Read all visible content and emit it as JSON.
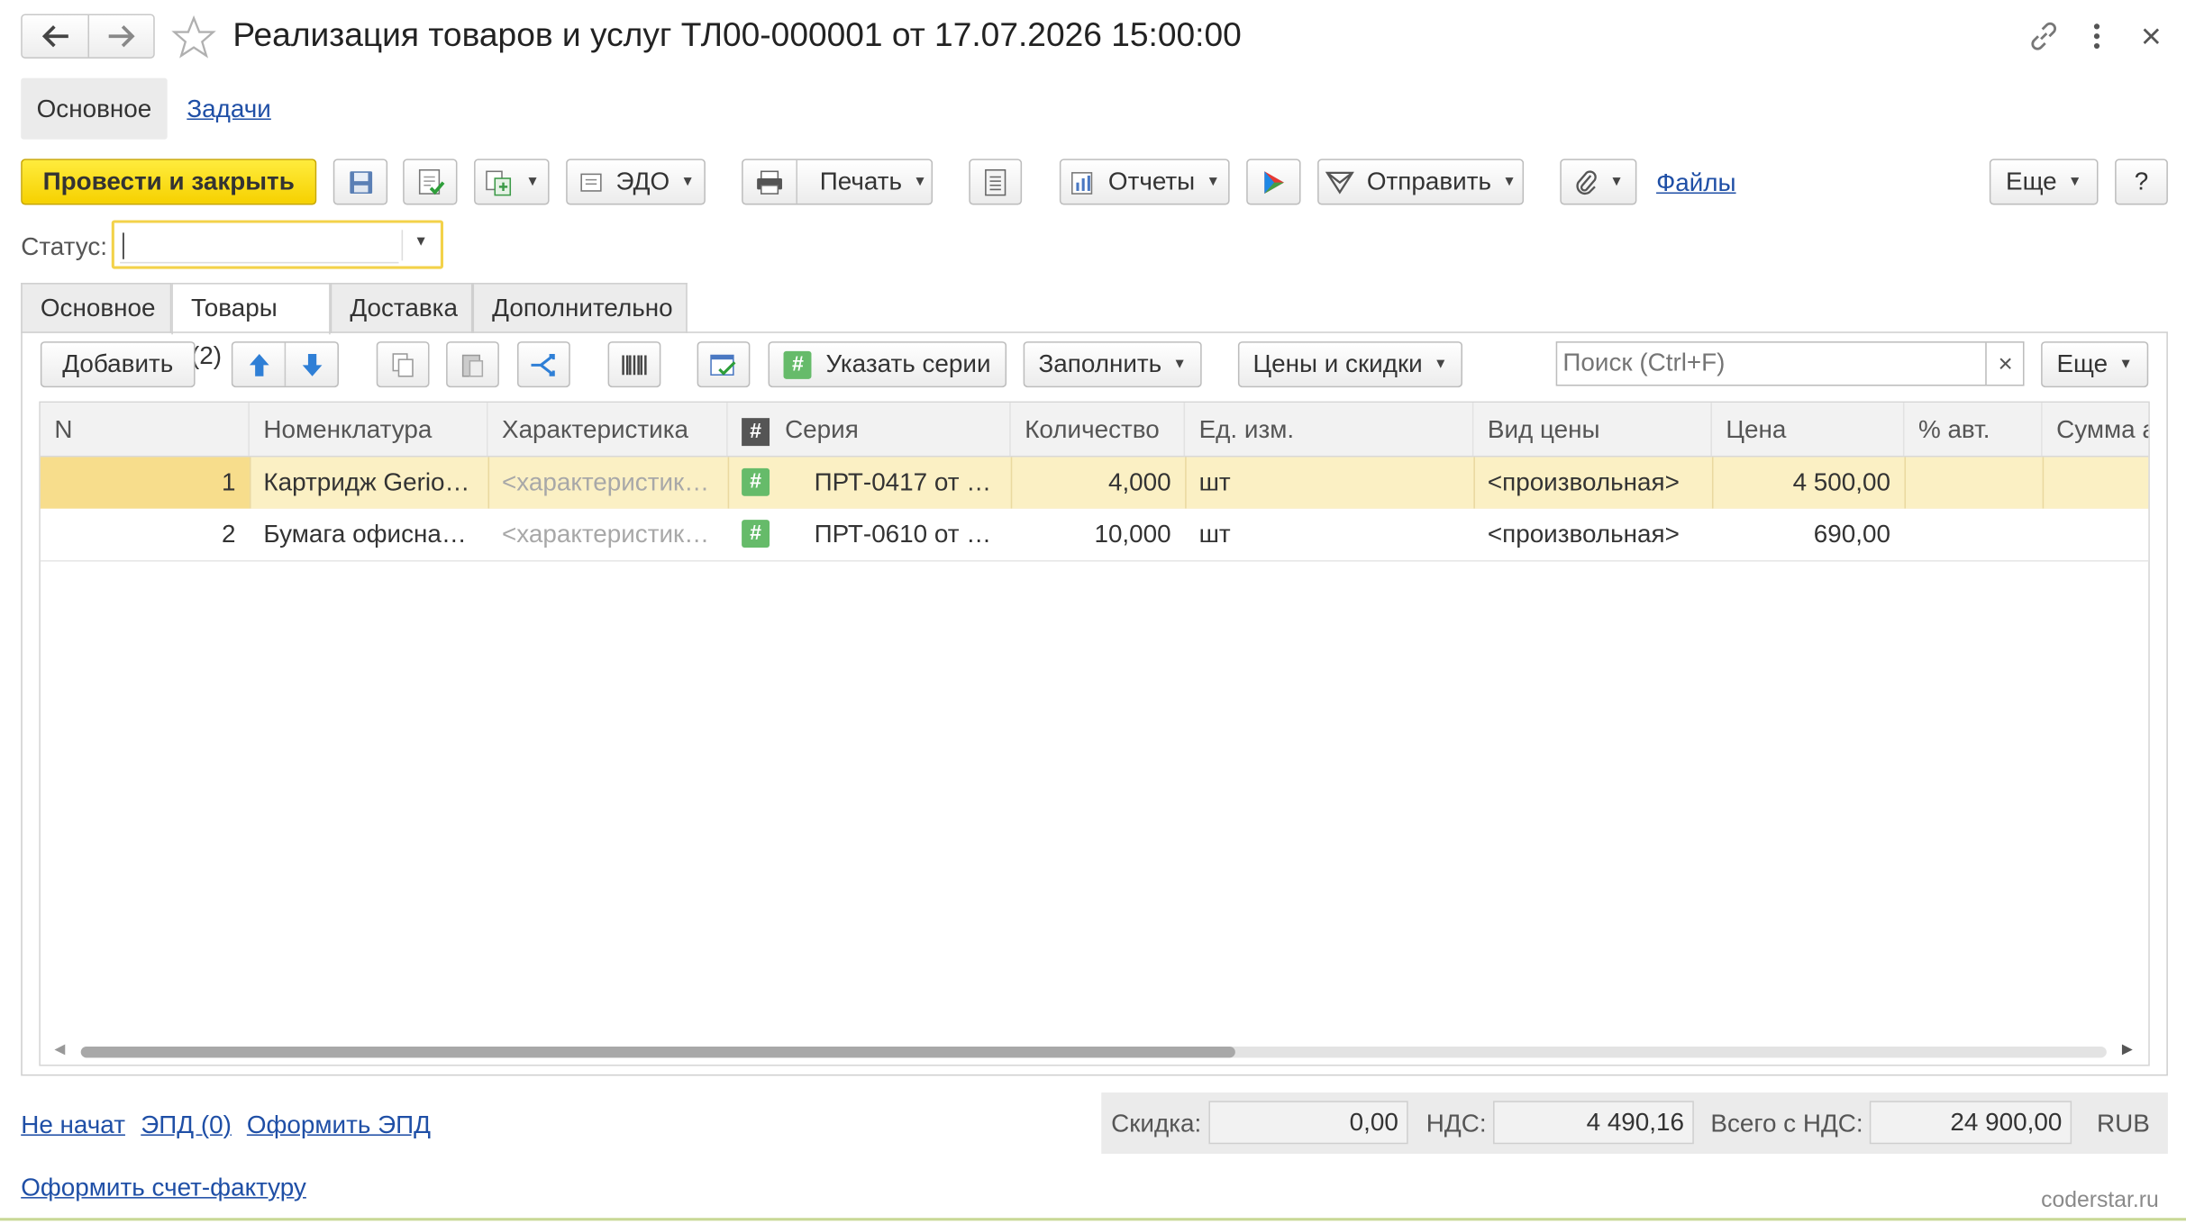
{
  "window": {
    "title": "Реализация товаров и услуг ТЛ00-000001 от 17.07.2026 15:00:00"
  },
  "nav": {
    "main": "Основное",
    "tasks": "Задачи"
  },
  "toolbar": {
    "post_close": "Провести и закрыть",
    "edo": "ЭДО",
    "print": "Печать",
    "reports": "Отчеты",
    "send": "Отправить",
    "files": "Файлы",
    "more": "Еще",
    "help": "?"
  },
  "status": {
    "label": "Статус:",
    "value": ""
  },
  "tabs": [
    "Основное",
    "Товары (2)",
    "Доставка",
    "Дополнительно"
  ],
  "goods_toolbar": {
    "add": "Добавить",
    "series": "Указать серии",
    "fill": "Заполнить",
    "prices": "Цены и скидки",
    "search_placeholder": "Поиск (Ctrl+F)",
    "clear": "×",
    "more": "Еще"
  },
  "table": {
    "columns": [
      "N",
      "Номенклатура",
      "Характеристика",
      "Серия",
      "Количество",
      "Ед. изм.",
      "Вид цены",
      "Цена",
      "% авт.",
      "Сумма а"
    ],
    "series_icon_header": "#",
    "rows": [
      {
        "n": "1",
        "item": "Картридж Gerio…",
        "char": "<характеристик…",
        "series": "ПРТ-0417 от …",
        "qty": "4,000",
        "unit": "шт",
        "price_type": "<произвольная>",
        "price": "4 500,00",
        "auto_pct": "",
        "sum": ""
      },
      {
        "n": "2",
        "item": "Бумага офисна…",
        "char": "<характеристик…",
        "series": "ПРТ-0610 от …",
        "qty": "10,000",
        "unit": "шт",
        "price_type": "<произвольная>",
        "price": "690,00",
        "auto_pct": "",
        "sum": ""
      }
    ],
    "scroll_position": 0.57
  },
  "footer": {
    "not_started": "Не начат",
    "epd": "ЭПД (0)",
    "make_epd": "Оформить ЭПД",
    "make_invoice": "Оформить счет-фактуру",
    "discount_label": "Скидка:",
    "discount": "0,00",
    "vat_label": "НДС:",
    "vat": "4 490,16",
    "total_label": "Всего с НДС:",
    "total": "24 900,00",
    "currency": "RUB"
  },
  "watermark": "coderstar.ru"
}
